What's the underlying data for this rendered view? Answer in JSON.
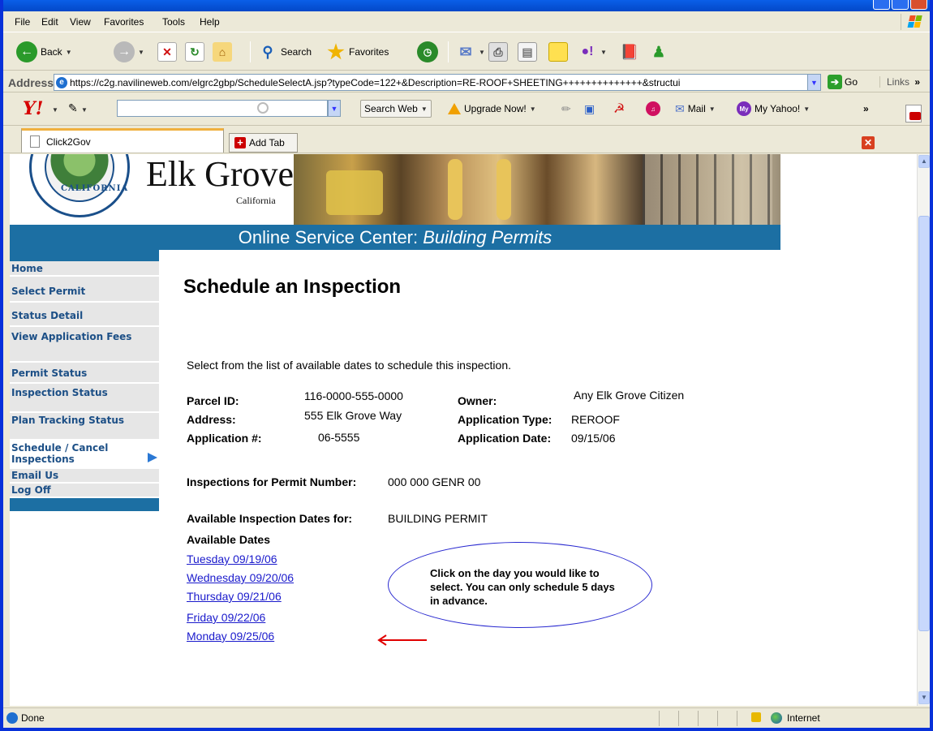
{
  "browser": {
    "title": "",
    "menu": [
      "File",
      "Edit",
      "View",
      "Favorites",
      "Tools",
      "Help"
    ],
    "toolbar": {
      "back_label": "Back",
      "search_label": "Search",
      "favorites_label": "Favorites"
    },
    "address": {
      "label": "Address",
      "url": "https://c2g.navilineweb.com/elgrc2gbp/ScheduleSelectA.jsp?typeCode=122+&Description=RE-ROOF+SHEETING++++++++++++++&structui",
      "go_label": "Go",
      "links_label": "Links"
    },
    "yahoo": {
      "search_value": "",
      "search_web_label": "Search Web",
      "upgrade_label": "Upgrade Now!",
      "mail_label": "Mail",
      "my_yahoo_label": "My Yahoo!",
      "more_label": "»"
    },
    "tabs": [
      {
        "label": "Click2Gov"
      }
    ],
    "add_tab_label": "Add Tab",
    "status": {
      "text": "Done",
      "zone": "Internet"
    }
  },
  "site": {
    "brand": "Elk Grove",
    "brand_sub": "California",
    "seal_text": "CALIFORNIA",
    "banner_prefix": "Online Service Center: ",
    "banner_accent": "Building Permits"
  },
  "nav": [
    {
      "label": "Home"
    },
    {
      "label": "Select Permit"
    },
    {
      "label": "Status Detail"
    },
    {
      "label": "View Application Fees"
    },
    {
      "label": "Permit Status"
    },
    {
      "label": "Inspection Status"
    },
    {
      "label": "Plan Tracking Status"
    },
    {
      "label": "Schedule / Cancel Inspections"
    },
    {
      "label": "Email Us"
    },
    {
      "label": "Log Off"
    }
  ],
  "page": {
    "title": "Schedule an Inspection",
    "intro": "Select from the list of available dates to schedule this inspection.",
    "parcel_label": "Parcel ID:",
    "parcel_value": "116-0000-555-0000",
    "address_label": "Address:",
    "address_value": "555 Elk Grove Way",
    "app_no_label": "Application #:",
    "app_no_value": "06-5555",
    "owner_label": "Owner:",
    "owner_value": "Any Elk Grove Citizen",
    "app_type_label": "Application Type:",
    "app_type_value": "REROOF",
    "app_date_label": "Application Date:",
    "app_date_value": "09/15/06",
    "permit_label": "Inspections for Permit Number:",
    "permit_value": "000 000 GENR 00",
    "avail_label": "Available Inspection Dates for:",
    "avail_value": "BUILDING PERMIT",
    "dates_heading": "Available Dates",
    "dates": [
      "Tuesday  09/19/06",
      "Wednesday 09/20/06",
      "Thursday  09/21/06",
      "Friday  09/22/06",
      "Monday  09/25/06"
    ],
    "callout": "Click on the day you would like to select. You can only schedule 5 days in advance."
  },
  "colors": {
    "site_blue": "#1c6fa3",
    "nav_text": "#1c4f86",
    "link": "#1a1acc",
    "arrow_red": "#e00000"
  }
}
